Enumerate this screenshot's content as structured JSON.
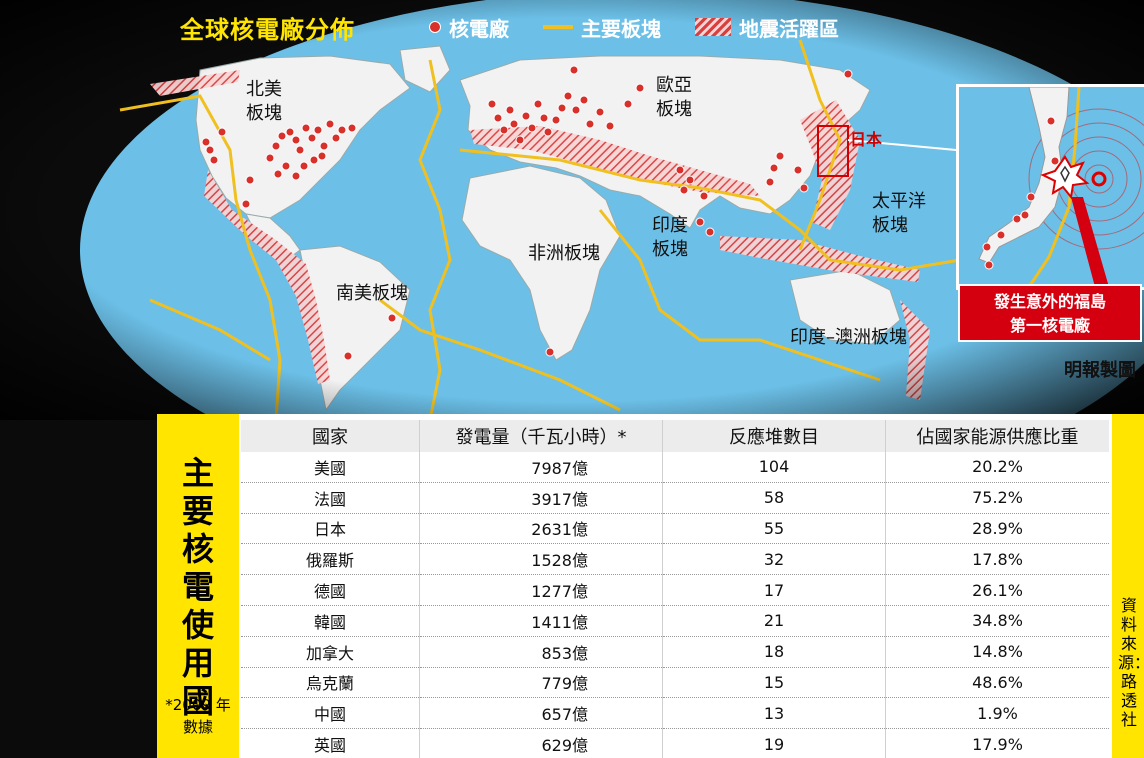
{
  "title": "全球核電廠分佈",
  "legend": {
    "plant": "核電廠",
    "plate": "主要板塊",
    "quake": "地震活躍區"
  },
  "plates": {
    "north_america": "北美\n板塊",
    "eurasia": "歐亞\n板塊",
    "pacific": "太平洋\n板塊",
    "india": "印度\n板塊",
    "africa": "非洲板塊",
    "south_america": "南美板塊",
    "indo_australia": "印度–澳洲板塊"
  },
  "japan_label": "日本",
  "fukushima_label": "發生意外的福島\n第一核電廠",
  "credit": "明報製圖",
  "table": {
    "side_title": "主要核電使用國",
    "note": "*2009 年\n數據",
    "source": "資料來源：路透社",
    "headers": [
      "國家",
      "發電量（千瓦小時）*",
      "反應堆數目",
      "佔國家能源供應比重"
    ],
    "rows": [
      [
        "美國",
        "7987億",
        "104",
        "20.2%"
      ],
      [
        "法國",
        "3917億",
        "58",
        "75.2%"
      ],
      [
        "日本",
        "2631億",
        "55",
        "28.9%"
      ],
      [
        "俄羅斯",
        "1528億",
        "32",
        "17.8%"
      ],
      [
        "德國",
        "1277億",
        "17",
        "26.1%"
      ],
      [
        "韓國",
        "1411億",
        "21",
        "34.8%"
      ],
      [
        "加拿大",
        "853億",
        "18",
        "14.8%"
      ],
      [
        "烏克蘭",
        "779億",
        "15",
        "48.6%"
      ],
      [
        "中國",
        "657億",
        "13",
        "1.9%"
      ],
      [
        "英國",
        "629億",
        "19",
        "17.9%"
      ]
    ]
  },
  "colors": {
    "ocean": "#6cc0e8",
    "land": "#f2f2f2",
    "plate_line": "#f0c020",
    "plant": "#d8302a",
    "accent_yellow": "#ffe500",
    "alert_red": "#d40010"
  }
}
